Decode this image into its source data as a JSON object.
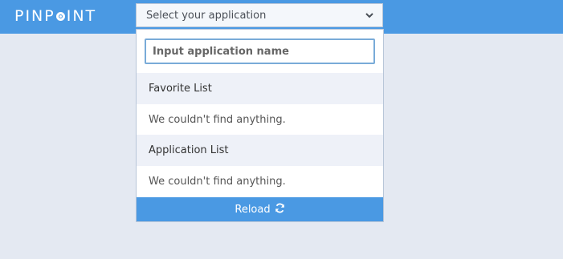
{
  "header": {
    "logo_left": "PINP",
    "logo_right": "INT",
    "right_faint_text": "",
    "background_color": "#4a99e3"
  },
  "app_selector": {
    "selected_label": "Select your application",
    "chevron_icon": "chevron-down-icon"
  },
  "dropdown": {
    "search_placeholder": "Input application name",
    "sections": [
      {
        "title": "Favorite List",
        "empty_text": "We couldn't find anything."
      },
      {
        "title": "Application List",
        "empty_text": "We couldn't find anything."
      }
    ],
    "reload_label": "Reload",
    "reload_icon": "refresh-icon"
  }
}
